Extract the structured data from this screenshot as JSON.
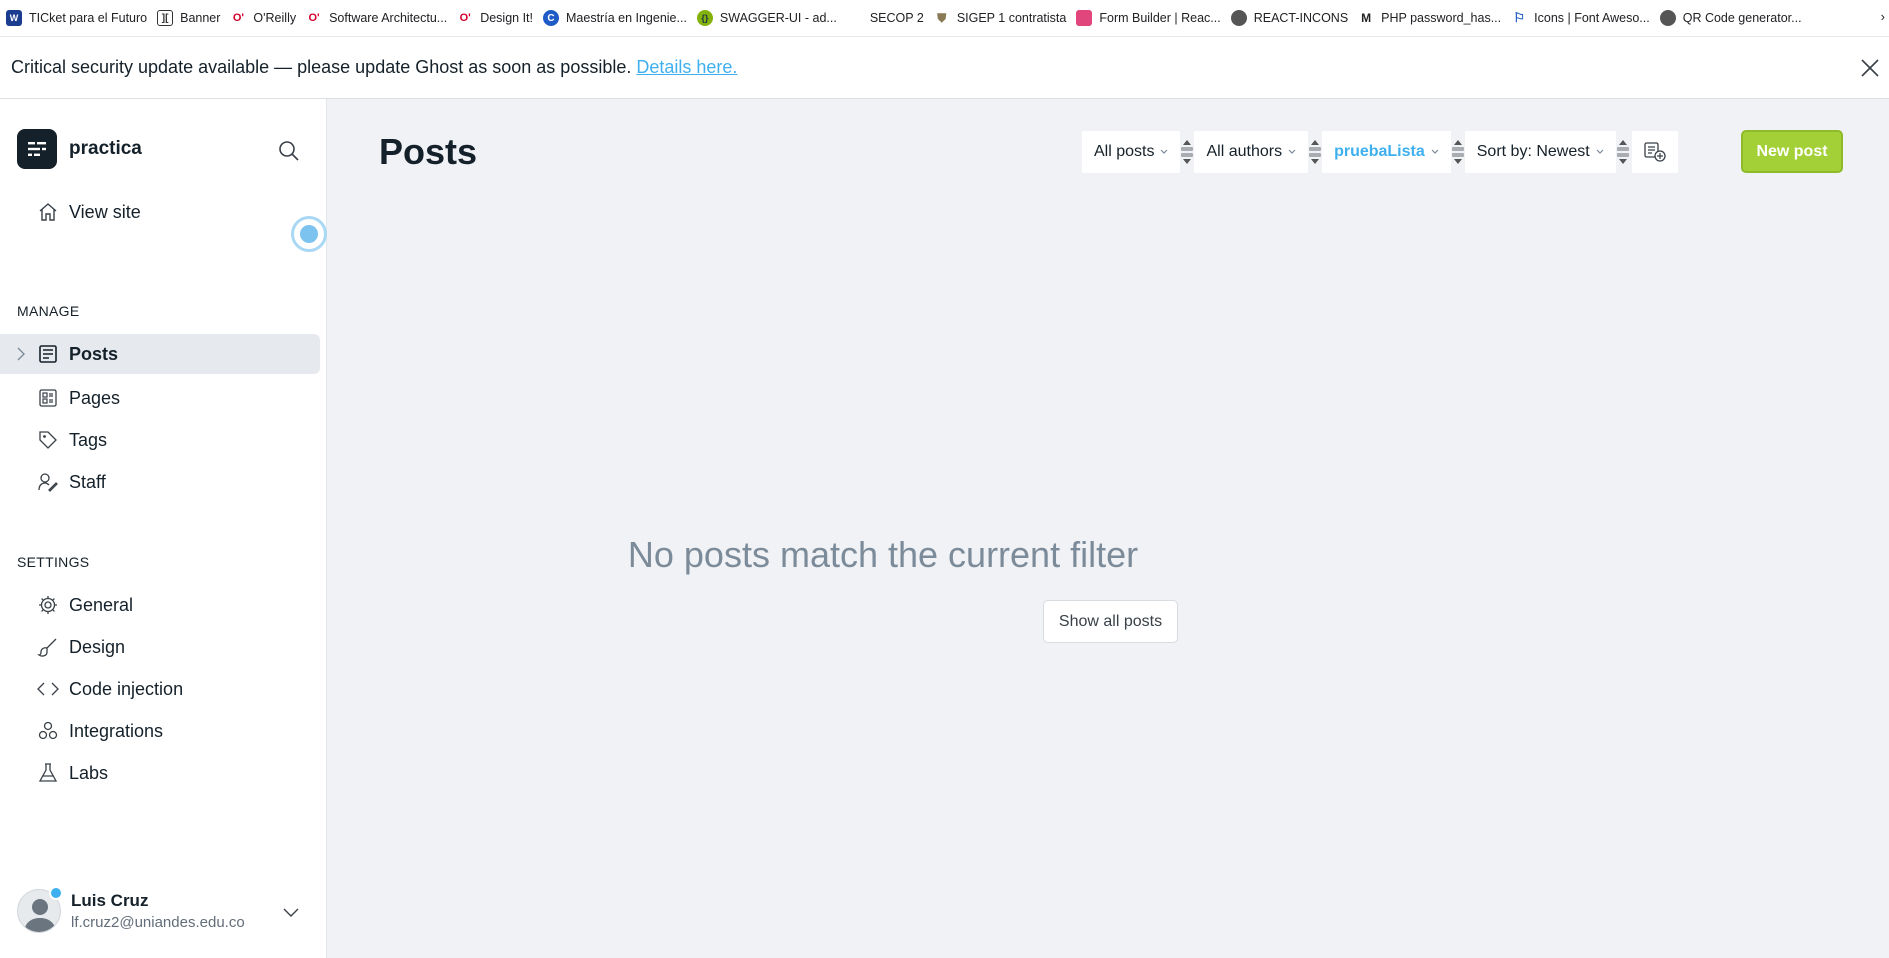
{
  "bookmarks": [
    {
      "label": "TICket para el Futuro",
      "icon": "ticket-icon",
      "color": "#1a3d8f"
    },
    {
      "label": "Banner",
      "icon": "banner-icon",
      "color": "#333333"
    },
    {
      "label": "O'Reilly",
      "icon": "oreilly-icon",
      "color": "#d3002d"
    },
    {
      "label": "Software Architectu...",
      "icon": "oreilly-icon",
      "color": "#d3002d"
    },
    {
      "label": "Design It!",
      "icon": "oreilly-icon",
      "color": "#d3002d"
    },
    {
      "label": "Maestría en Ingenie...",
      "icon": "globe-c-icon",
      "color": "#1e5bc6"
    },
    {
      "label": "SWAGGER-UI - ad...",
      "icon": "swagger-icon",
      "color": "#85b10d"
    },
    {
      "label": "SECOP 2",
      "icon": "blank-icon",
      "color": "#ffffff"
    },
    {
      "label": "SIGEP 1 contratista",
      "icon": "shield-icon",
      "color": "#8a7a55"
    },
    {
      "label": "Form Builder | Reac...",
      "icon": "form-icon",
      "color": "#e0457b"
    },
    {
      "label": "REACT-INCONS",
      "icon": "globe-icon",
      "color": "#555555"
    },
    {
      "label": "PHP password_has...",
      "icon": "php-icon",
      "color": "#222222"
    },
    {
      "label": "Icons | Font Aweso...",
      "icon": "flag-icon",
      "color": "#1e5bc6"
    },
    {
      "label": "QR Code generator...",
      "icon": "globe-icon",
      "color": "#555555"
    }
  ],
  "bookmarks_more": "›",
  "banner": {
    "text": "Critical security update available — please update Ghost as soon as possible.",
    "link": "Details here."
  },
  "sidebar": {
    "site_name": "practica",
    "view_site": "View site",
    "manage_label": "MANAGE",
    "manage_items": [
      {
        "label": "Posts",
        "icon": "posts-icon"
      },
      {
        "label": "Pages",
        "icon": "pages-icon"
      },
      {
        "label": "Tags",
        "icon": "tag-icon"
      },
      {
        "label": "Staff",
        "icon": "staff-icon"
      }
    ],
    "settings_label": "SETTINGS",
    "settings_items": [
      {
        "label": "General",
        "icon": "gear-icon"
      },
      {
        "label": "Design",
        "icon": "brush-icon"
      },
      {
        "label": "Code injection",
        "icon": "code-icon"
      },
      {
        "label": "Integrations",
        "icon": "integrations-icon"
      },
      {
        "label": "Labs",
        "icon": "flask-icon"
      }
    ],
    "user": {
      "name": "Luis Cruz",
      "email": "lf.cruz2@uniandes.edu.co"
    }
  },
  "main": {
    "title": "Posts",
    "filters": {
      "type": "All posts",
      "author": "All authors",
      "tag": "pruebaLista",
      "sort": "Sort by: Newest"
    },
    "new_post": "New post",
    "empty_message": "No posts match the current filter",
    "show_all": "Show all posts"
  },
  "colors": {
    "accent": "#3eb0ef",
    "primary_button": "#a4d037"
  }
}
